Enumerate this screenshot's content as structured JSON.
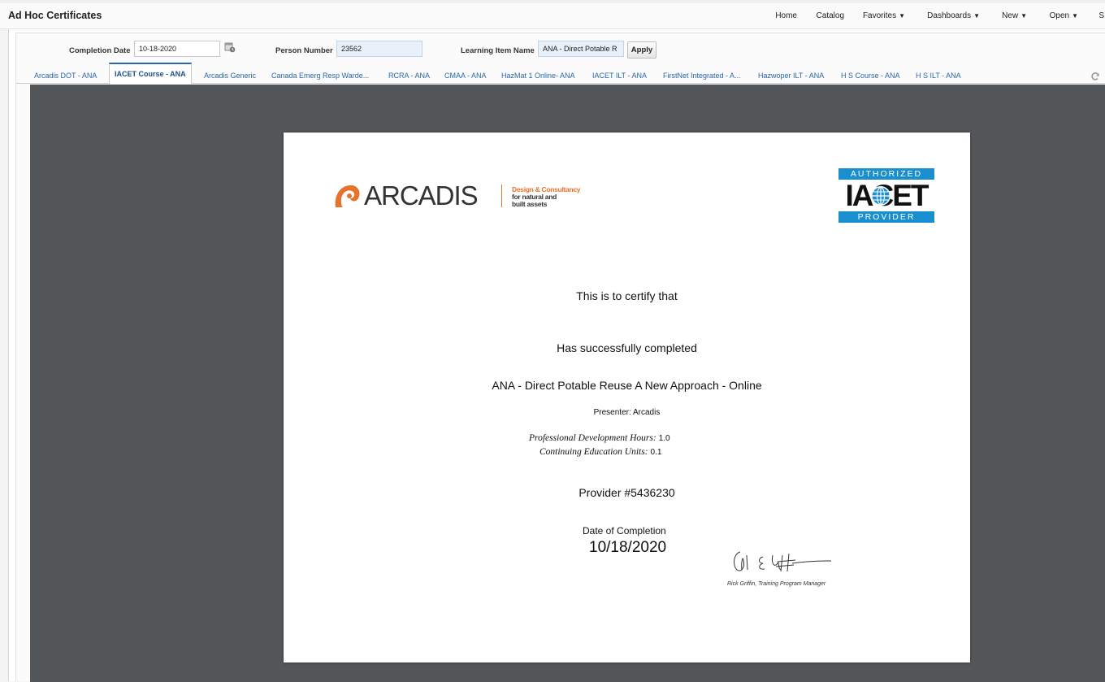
{
  "app": {
    "title": "Ad Hoc Certificates"
  },
  "topnav": {
    "home": "Home",
    "catalog": "Catalog",
    "favorites": "Favorites",
    "dashboards": "Dashboards",
    "new": "New",
    "open": "Open",
    "overflow": "S"
  },
  "prompts": {
    "completion_date_label": "Completion Date",
    "completion_date_value": "10-18-2020",
    "person_number_label": "Person Number",
    "person_number_value": "23562",
    "learning_item_label": "Learning Item Name",
    "learning_item_value": "ANA - Direct Potable R",
    "apply_label": "Apply"
  },
  "tabs": [
    {
      "label": "Arcadis DOT - ANA",
      "active": false
    },
    {
      "label": "IACET Course - ANA",
      "active": true
    },
    {
      "label": "Arcadis Generic",
      "active": false
    },
    {
      "label": "Canada Emerg Resp Warde...",
      "active": false
    },
    {
      "label": "RCRA - ANA",
      "active": false
    },
    {
      "label": "CMAA - ANA",
      "active": false
    },
    {
      "label": "HazMat 1 Online- ANA",
      "active": false
    },
    {
      "label": "IACET ILT - ANA",
      "active": false
    },
    {
      "label": "FirstNet Integrated - A...",
      "active": false
    },
    {
      "label": "Hazwoper ILT - ANA",
      "active": false
    },
    {
      "label": "H S Course - ANA",
      "active": false
    },
    {
      "label": "H S ILT - ANA",
      "active": false
    }
  ],
  "certificate": {
    "arcadis_logo": {
      "wordmark": "ARCADIS",
      "tagline_1": "Design & Consultancy",
      "tagline_2": "for natural and",
      "tagline_3": "built assets"
    },
    "iacet_badge": {
      "top": "AUTHORIZED",
      "word": "IACET",
      "bottom": "PROVIDER"
    },
    "certify_text": "This is to certify that",
    "completed_text": "Has successfully completed",
    "course_name": "ANA - Direct Potable Reuse A New Approach - Online",
    "presenter_label": "Presenter:",
    "presenter_value": "Arcadis",
    "pdh_label": "Professional Development Hours:",
    "pdh_value": "1.0",
    "ceu_label": "Continuing Education Units:",
    "ceu_value": "0.1",
    "provider": "Provider #5436230",
    "date_label": "Date of Completion",
    "date_value": "10/18/2020",
    "signer_caption": "Rick Griffin, Training Program Manager"
  },
  "colors": {
    "accent_blue": "#2a66a8",
    "arcadis_orange": "#e5732b",
    "iacet_blue": "#1a8fd0",
    "viewer_gray": "#545759"
  },
  "icons": {
    "calendar": "calendar-icon",
    "refresh": "refresh-icon",
    "dropdown": "caret-down-icon"
  }
}
